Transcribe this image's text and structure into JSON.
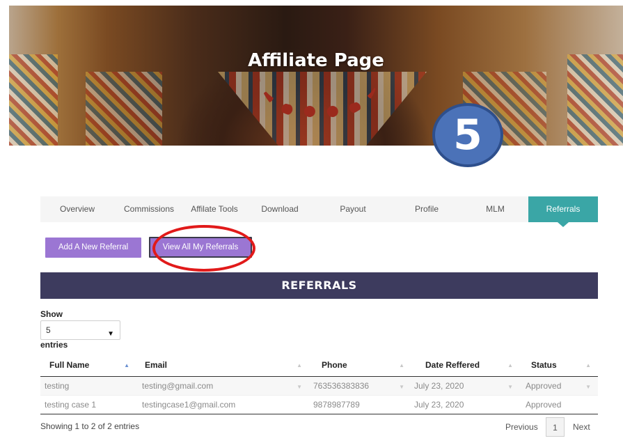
{
  "hero": {
    "title": "Affiliate Page"
  },
  "step_badge": "5",
  "tabs": [
    {
      "label": "Overview"
    },
    {
      "label": "Commissions"
    },
    {
      "label": "Affilate Tools"
    },
    {
      "label": "Download"
    },
    {
      "label": "Payout"
    },
    {
      "label": "Profile"
    },
    {
      "label": "MLM"
    },
    {
      "label": "Referrals",
      "active": true
    }
  ],
  "buttons": {
    "add_referral": "Add A New Referral",
    "view_all": "View All My Referrals"
  },
  "section": {
    "title": "REFERRALS"
  },
  "length_menu": {
    "show_label": "Show",
    "selected": "5",
    "entries_label": "entries"
  },
  "table": {
    "columns": [
      "Full Name",
      "Email",
      "Phone",
      "Date Reffered",
      "Status"
    ],
    "rows": [
      {
        "name": "testing",
        "email": "testing@gmail.com",
        "phone": "763536383836",
        "date": "July 23, 2020",
        "status": "Approved"
      },
      {
        "name": "testing case 1",
        "email": "testingcase1@gmail.com",
        "phone": "9878987789",
        "date": "July 23, 2020",
        "status": "Approved"
      }
    ]
  },
  "footer": {
    "info": "Showing 1 to 2 of 2 entries",
    "previous": "Previous",
    "page": "1",
    "next": "Next"
  },
  "colors": {
    "accent_purple": "#9b76d3",
    "tab_active": "#3aa6a6",
    "header_bar": "#3d3b5e",
    "annotation_red": "#e11a1a",
    "badge_blue": "#4b72b8"
  }
}
